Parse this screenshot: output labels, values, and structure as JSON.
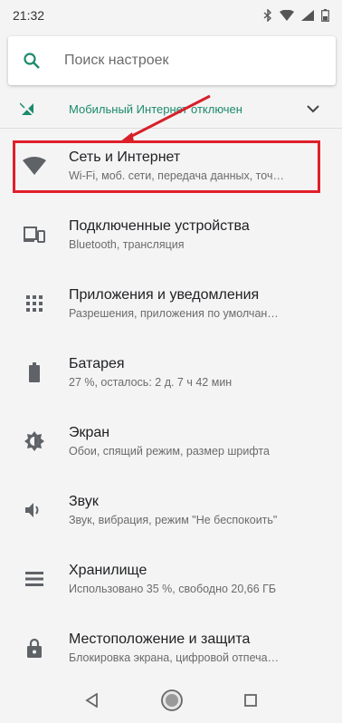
{
  "status_bar": {
    "time": "21:32"
  },
  "search": {
    "placeholder": "Поиск настроек"
  },
  "suggestion": {
    "text": "Мобильный Интернет отключен"
  },
  "settings": [
    {
      "title": "Сеть и Интернет",
      "subtitle": "Wi-Fi, моб. сети, передача данных, точ…",
      "icon": "wifi-icon"
    },
    {
      "title": "Подключенные устройства",
      "subtitle": "Bluetooth, трансляция",
      "icon": "devices-icon"
    },
    {
      "title": "Приложения и уведомления",
      "subtitle": "Разрешения, приложения по умолчан…",
      "icon": "apps-icon"
    },
    {
      "title": "Батарея",
      "subtitle": "27 %, осталось: 2 д. 7 ч 42 мин",
      "icon": "battery-icon"
    },
    {
      "title": "Экран",
      "subtitle": "Обои, спящий режим, размер шрифта",
      "icon": "brightness-icon"
    },
    {
      "title": "Звук",
      "subtitle": "Звук, вибрация, режим \"Не беспокоить\"",
      "icon": "volume-icon"
    },
    {
      "title": "Хранилище",
      "subtitle": "Использовано 35 %, свободно 20,66 ГБ",
      "icon": "storage-icon"
    },
    {
      "title": "Местоположение и защита",
      "subtitle": "Блокировка экрана, цифровой отпеча…",
      "icon": "lock-icon"
    }
  ],
  "colors": {
    "accent": "#1d8a6c",
    "highlight": "#e01f2a",
    "icon": "#5f6368"
  }
}
